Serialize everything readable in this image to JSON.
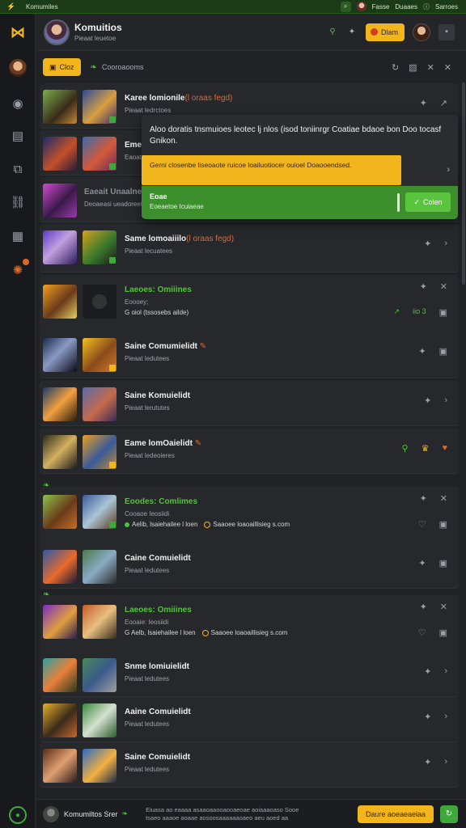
{
  "topbar": {
    "title": "Komumiles",
    "user1": "Fasse",
    "user2": "Duaaes",
    "user3": "Sarroes"
  },
  "header": {
    "title": "Komuitios",
    "subtitle": "Pieaat leuetoe",
    "button_label": "Dlam"
  },
  "filter": {
    "chip_label": "Cloz",
    "label": "Cooroaooms"
  },
  "rows": [
    {
      "title": "Karee lomionile",
      "accent": "(l oraas fegd)",
      "sub": "Pieaat ledrctoes"
    },
    {
      "title": "Eme",
      "accent": "",
      "sub": "Eaoats"
    },
    {
      "title": "Eaeait Unaalne",
      "accent": "",
      "sub": "Deoaeasi ueadoreet"
    },
    {
      "title": "Same lomoaiiilo",
      "accent": "(l oraas fegd)",
      "sub": "Pieaat lecuatees"
    },
    {
      "title": "Laeoes: Omiiines",
      "accent": "",
      "sub": "Eoooey;",
      "extra": "G oiol (tssosebs ailde)",
      "extra_stat": "iio 3"
    },
    {
      "title": "Saine Comumielidt",
      "accent": "",
      "sub": "Pieaat ledutees"
    },
    {
      "title": "Saine Komuielidt",
      "accent": "",
      "sub": "Pieaat lerututes"
    },
    {
      "title": "Eame lomOaielidt",
      "accent": "",
      "sub": "Pieaat ledeoieres"
    },
    {
      "title": "Eoodes: Comlimes",
      "accent": "",
      "sub": "Cooaoe Ieosiidi",
      "extra": "Aelib, lsaiehailee l loen",
      "extra2": "Saaoee loaoaillisieg s.com"
    },
    {
      "title": "Caine Comuielidt",
      "accent": "",
      "sub": "Pieaat ledutees"
    },
    {
      "title": "Laeoes: Omiiines",
      "accent": "",
      "sub": "Eooaie: Ieosiidi",
      "extra": "G Aelb, lsaiehailee l loen",
      "extra2": "Saaoee loaoaillisieg s.com"
    },
    {
      "title": "Snme lomiuielidt",
      "accent": "",
      "sub": "Pieaat ledutees"
    },
    {
      "title": "Aaine Comuielidt",
      "accent": "",
      "sub": "Pieaat ledutees"
    },
    {
      "title": "Saine Comuielidt",
      "accent": "",
      "sub": "Pieaat ledutees"
    }
  ],
  "popup": {
    "text": "Aloo doratis tnsmuioes leotec lj nlos (isod toniinrgr Coatiae bdaoe bon Doo tocasf Gnikon.",
    "warning": "Gerni closenbe liseoaote ruicoe loailuotiocer ouioel Doaooendsed.",
    "ok_title": "Eoae",
    "ok_sub": "Eoeaetoe Icuiaeae",
    "ok_button": "Colen"
  },
  "bottombar": {
    "name": "Komumiltos Srer",
    "info": "Eiuasa ao eaaaa asaaoaaooaooaeoae aoiaaaoaso Sooe tsaeo aaaoe aoaae aosoosaaaaaaoaeo aeu aoed aa",
    "button_label": "Daure aoeaeaeiaa"
  },
  "colors": {
    "accent_yellow": "#f2b51c",
    "accent_green": "#3ea83a",
    "accent_orange": "#e0672a",
    "background": "#202226"
  }
}
